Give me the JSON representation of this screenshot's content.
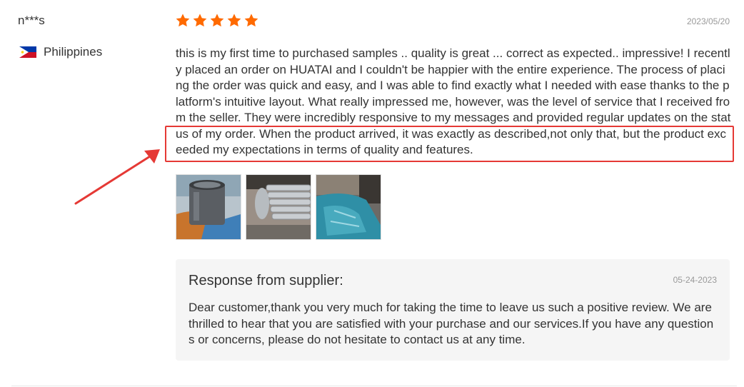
{
  "reviewer": {
    "name": "n***s",
    "country": "Philippines"
  },
  "review": {
    "rating": 5,
    "rating_max": 5,
    "date": "2023/05/20",
    "text": "this is my first time to purchased samples .. quality is great ... correct as expected.. impressive! I recently placed an order on HUATAI and I couldn't be happier with the entire experience. The process of placing the order was quick and easy, and I was able to find exactly what I needed with ease thanks to the platform's intuitive layout. What really impressed me, however, was the level of service that I received from the seller. They were incredibly responsive to my messages and provided regular updates on the status of my order. When the product arrived, it was exactly as described,not only that, but the product exceeded my expectations in terms of quality and features.",
    "photos": [
      "cylinder-liner-photo",
      "bearing-shells-photo",
      "wrapped-part-photo"
    ]
  },
  "response": {
    "title": "Response from supplier:",
    "date": "05-24-2023",
    "text": "Dear customer,thank you very much for taking the time to leave us such a positive review. We are thrilled to hear that you are satisfied with your purchase and our services.If you have any questions or concerns, please do not hesitate to contact us at any time."
  },
  "colors": {
    "star": "#ff6a00",
    "highlight": "#e53935",
    "response_bg": "#f5f5f5"
  }
}
